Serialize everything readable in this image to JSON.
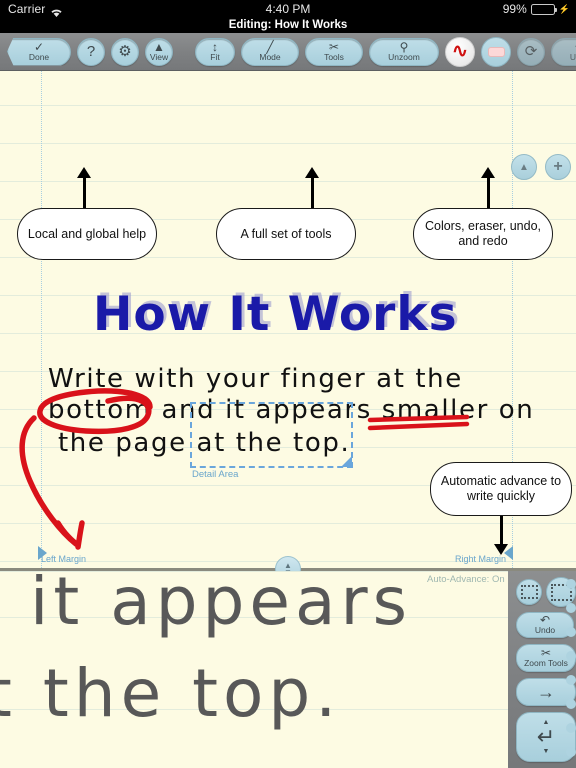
{
  "status_bar": {
    "carrier": "Carrier",
    "wifi_icon": "wifi-icon",
    "time": "4:40 PM",
    "battery_percent": "99%",
    "battery_level": 99,
    "charging_icon": "lightning-bolt-icon"
  },
  "title_bar": {
    "title": "Editing: How It Works"
  },
  "toolbar": {
    "left_group": [
      {
        "name": "done-button",
        "label": "Done",
        "glyph": "✓",
        "icon": "checkmark-icon",
        "shape": "tab",
        "enabled": true
      },
      {
        "name": "help-button",
        "label": "",
        "glyph": "?",
        "icon": "question-mark-icon",
        "shape": "circle",
        "enabled": true
      },
      {
        "name": "settings-button",
        "label": "",
        "glyph": "⚙",
        "icon": "gear-icon",
        "shape": "circle",
        "enabled": true
      },
      {
        "name": "view-button",
        "label": "View",
        "glyph": "▲",
        "icon": "eye-icon",
        "shape": "circle",
        "enabled": true
      }
    ],
    "right_group": [
      {
        "name": "fit-button",
        "label": "Fit",
        "glyph": "↕",
        "icon": "up-down-arrows-icon",
        "shape": "pill-sm",
        "enabled": true
      },
      {
        "name": "mode-button",
        "label": "Mode",
        "glyph": "╱",
        "icon": "pen-icon",
        "shape": "pill",
        "enabled": true
      },
      {
        "name": "tools-button",
        "label": "Tools",
        "glyph": "✂",
        "icon": "tools-icon",
        "shape": "pill",
        "enabled": true
      },
      {
        "name": "unzoom-button",
        "label": "Unzoom",
        "glyph": "⚲",
        "icon": "magnifier-minus-icon",
        "shape": "pill-lg",
        "enabled": true
      },
      {
        "name": "pen-color-button",
        "label": "",
        "glyph": "∿",
        "icon": "red-squiggle-icon",
        "shape": "pen",
        "enabled": true
      },
      {
        "name": "eraser-button",
        "label": "",
        "glyph": "",
        "icon": "eraser-icon",
        "shape": "eraser",
        "enabled": true
      },
      {
        "name": "redo-button",
        "label": "",
        "glyph": "⟳",
        "icon": "redo-arrow-icon",
        "shape": "circle",
        "enabled": false
      },
      {
        "name": "undo-button",
        "label": "Undo",
        "glyph": "↶",
        "icon": "undo-arrow-icon",
        "shape": "pill",
        "enabled": false
      }
    ]
  },
  "page": {
    "heading": "How It Works",
    "handwriting_lines": [
      "Write with your finger at the",
      "bottom and it appears smaller on",
      "the page at the top."
    ],
    "detail_area_label": "Detail Area",
    "left_margin_label": "Left Margin",
    "right_margin_label": "Right Margin",
    "corner_controls": [
      {
        "name": "collapse-toolbar-button",
        "glyph": "▲",
        "icon": "triangle-up-icon"
      },
      {
        "name": "add-page-button",
        "glyph": "+",
        "icon": "plus-icon"
      }
    ],
    "callouts": [
      {
        "name": "callout-help",
        "text": "Local and global help"
      },
      {
        "name": "callout-tools",
        "text": "A full set of tools"
      },
      {
        "name": "callout-colors",
        "text": "Colors, eraser, undo, and redo"
      },
      {
        "name": "callout-auto-advance",
        "text": "Automatic advance to write quickly"
      }
    ],
    "ink_annotations": [
      {
        "name": "red-circle-annotation",
        "target": "bottom",
        "color": "#d9121a"
      },
      {
        "name": "red-arrow-annotation",
        "color": "#d9121a"
      },
      {
        "name": "red-double-underline-annotation",
        "target": "smaller",
        "color": "#d9121a"
      }
    ],
    "colors": {
      "paper": "#fdfbe3",
      "rule_line": "#e3ecdc",
      "heading": "#1a1aa8",
      "ink_red": "#d9121a",
      "margin_blue": "#6aa6cc"
    }
  },
  "zoom_panel": {
    "handwriting_lines": [
      "it appears",
      "t the top."
    ],
    "auto_advance_status": "Auto-Advance: On",
    "divider_handle_icon": "up-down-drag-handle-icon",
    "controls": [
      {
        "name": "selection-small-button",
        "label": "",
        "icon": "dotted-square-small-icon"
      },
      {
        "name": "selection-large-button",
        "label": "",
        "icon": "dotted-square-large-icon"
      },
      {
        "name": "zoom-undo-button",
        "label": "Undo",
        "glyph": "↶",
        "icon": "undo-arrow-icon"
      },
      {
        "name": "zoom-tools-button",
        "label": "Zoom Tools",
        "glyph": "✂",
        "icon": "tools-icon"
      },
      {
        "name": "advance-button",
        "label": "",
        "glyph": "→",
        "icon": "right-arrow-icon"
      },
      {
        "name": "return-button",
        "label": "",
        "glyph": "↵",
        "icon": "return-arrow-icon"
      }
    ]
  }
}
